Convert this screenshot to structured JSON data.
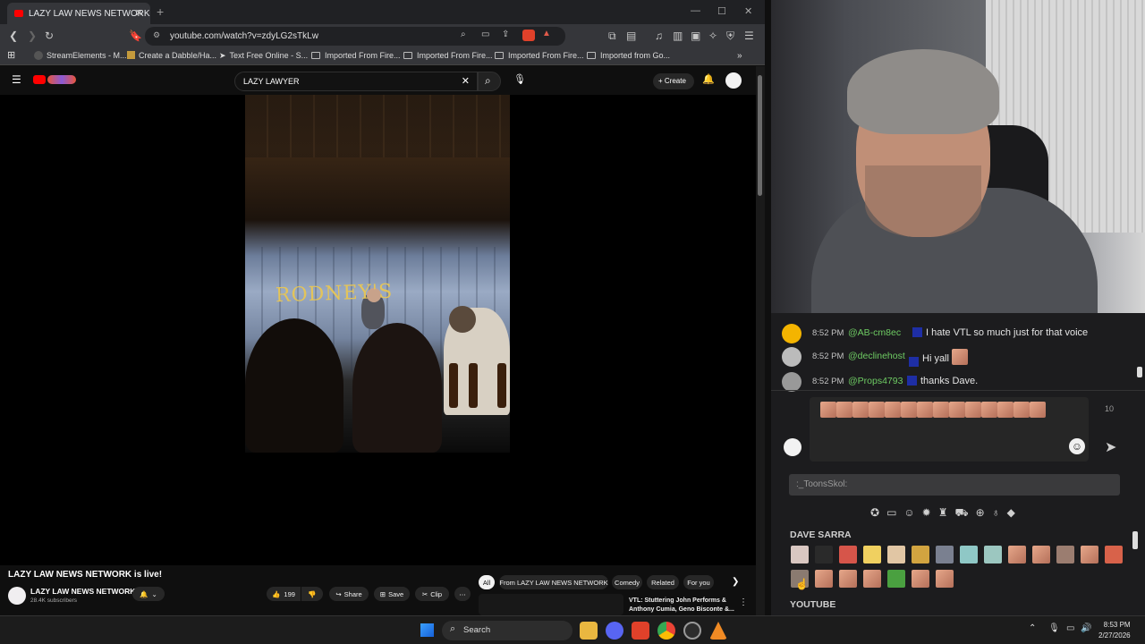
{
  "browser": {
    "tab_title": "LAZY LAW NEWS NETWORK",
    "url": "youtube.com/watch?v=zdyLG2sTkLw",
    "bookmarks": [
      "StreamElements - M...",
      "Create a Dabble/Ha...",
      "Text Free Online - S...",
      "Imported From Fire...",
      "Imported From Fire...",
      "Imported From Fire...",
      "Imported from Go..."
    ]
  },
  "youtube": {
    "search_value": "LAZY LAWYER",
    "create_label": "Create",
    "stage_sign": "RODNEY'S",
    "video_title": "LAZY LAW NEWS NETWORK is live!",
    "channel_name": "LAZY LAW NEWS NETWORK",
    "subscribers": "28.4K subscribers",
    "like_count": "199",
    "share_label": "Share",
    "save_label": "Save",
    "clip_label": "Clip",
    "chips": [
      "All",
      "From LAZY LAW NEWS NETWORK",
      "Comedy",
      "Related",
      "For you"
    ],
    "rec_title_line1": "VTL: Stuttering John Performs &",
    "rec_title_line2": "Anthony Cumia, Geno Bisconte &..."
  },
  "chat": {
    "messages": [
      {
        "time": "8:52 PM",
        "user": "@AB-cm8ec",
        "text": "I hate VTL so much just for that voice"
      },
      {
        "time": "8:52 PM",
        "user": "@declinehost",
        "text": "Hi yall"
      },
      {
        "time": "8:52 PM",
        "user": "@Props4793",
        "text": "thanks Dave."
      }
    ],
    "char_count": "10",
    "emote_search_placeholder": ":_ToonsSkol:",
    "section_dave": "DAVE SARRA",
    "section_youtube": "YOUTUBE"
  },
  "taskbar": {
    "search_label": "Search",
    "time": "8:53 PM",
    "date": "2/27/2026"
  },
  "colors": {
    "yt_red": "#ff0000",
    "chat_user": "#6ecb63",
    "chat_bg": "#1c1c1e",
    "accent_blue": "#1e2ea5"
  }
}
